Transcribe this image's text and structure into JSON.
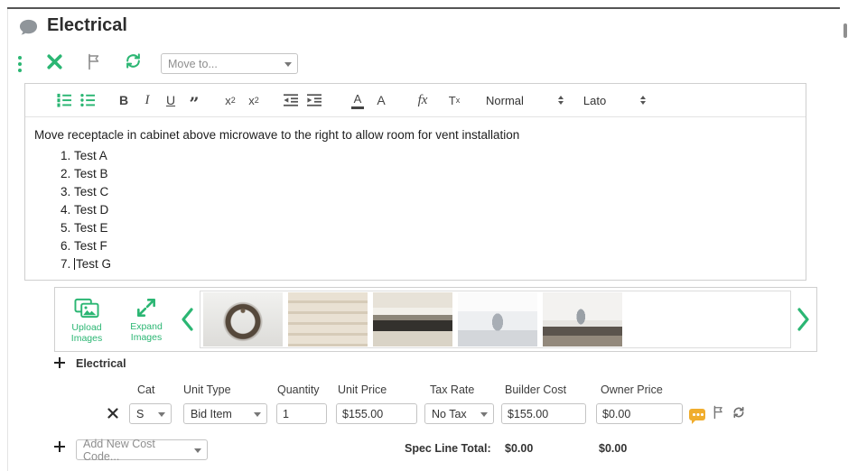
{
  "colors": {
    "accent_green": "#2bb673",
    "comment_yellow": "#f0ad2d"
  },
  "header": {
    "title": "Electrical"
  },
  "action_bar": {
    "move_to_placeholder": "Move to..."
  },
  "editor": {
    "toolbar": {
      "bold": "B",
      "italic": "I",
      "underline": "U",
      "quote": "”",
      "sub_base": "x",
      "sub_small": "2",
      "sup_base": "x",
      "sup_small": "2",
      "font_color_letter": "A",
      "bg_color_letter": "A",
      "math_label": "fx",
      "clear_base": "T",
      "clear_small": "x",
      "paragraph_style": "Normal",
      "font_name": "Lato"
    },
    "content": {
      "paragraph": "Move receptacle in cabinet above microwave to the right to allow room for vent installation",
      "list_items": [
        "Test A",
        "Test B",
        "Test C",
        "Test D",
        "Test E",
        "Test F",
        "Test G"
      ]
    }
  },
  "gallery": {
    "upload_label": "Upload Images",
    "expand_label": "Expand Images",
    "thumbs": [
      "chandelier light fixture",
      "cabinet slat doors",
      "farmhouse sink",
      "bathroom faucet",
      "kitchen faucet",
      "empty slot"
    ]
  },
  "costs": {
    "section_title": "Electrical",
    "headers": [
      "Cat",
      "Unit Type",
      "Quantity",
      "Unit Price",
      "Tax Rate",
      "Builder Cost",
      "Owner Price"
    ],
    "row": {
      "cat": "S",
      "unit_type": "Bid Item",
      "quantity": "1",
      "unit_price": "$155.00",
      "tax_rate": "No Tax",
      "builder_cost": "$155.00",
      "owner_price": "$0.00"
    },
    "add_new_placeholder": "Add New Cost Code...",
    "spec_total_label": "Spec Line Total:",
    "spec_total_builder": "$0.00",
    "spec_total_owner": "$0.00"
  }
}
